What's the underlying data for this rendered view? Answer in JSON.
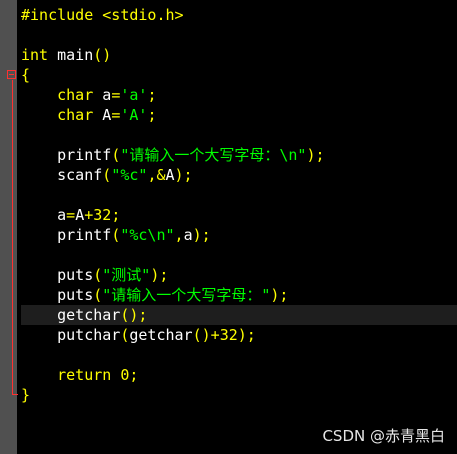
{
  "editor": {
    "lines": [
      [
        {
          "t": "#include <stdio.h>",
          "c": "pre"
        }
      ],
      [],
      [
        {
          "t": "int",
          "c": "kw"
        },
        {
          "t": " main",
          "c": "id"
        },
        {
          "t": "()",
          "c": "br"
        }
      ],
      [
        {
          "t": "{",
          "c": "br"
        }
      ],
      [
        {
          "t": "    char",
          "c": "kw"
        },
        {
          "t": " a",
          "c": "id"
        },
        {
          "t": "=",
          "c": "op"
        },
        {
          "t": "'a'",
          "c": "str"
        },
        {
          "t": ";",
          "c": "op"
        }
      ],
      [
        {
          "t": "    char",
          "c": "kw"
        },
        {
          "t": " A",
          "c": "id"
        },
        {
          "t": "=",
          "c": "op"
        },
        {
          "t": "'A'",
          "c": "str"
        },
        {
          "t": ";",
          "c": "op"
        }
      ],
      [],
      [
        {
          "t": "    printf",
          "c": "id"
        },
        {
          "t": "(",
          "c": "br"
        },
        {
          "t": "\"请输入一个大写字母：\\n\"",
          "c": "str"
        },
        {
          "t": ");",
          "c": "op"
        }
      ],
      [
        {
          "t": "    scanf",
          "c": "id"
        },
        {
          "t": "(",
          "c": "br"
        },
        {
          "t": "\"%c\"",
          "c": "str"
        },
        {
          "t": ",&",
          "c": "op"
        },
        {
          "t": "A",
          "c": "id"
        },
        {
          "t": ");",
          "c": "op"
        }
      ],
      [],
      [
        {
          "t": "    a",
          "c": "id"
        },
        {
          "t": "=",
          "c": "op"
        },
        {
          "t": "A",
          "c": "id"
        },
        {
          "t": "+",
          "c": "op"
        },
        {
          "t": "32",
          "c": "num"
        },
        {
          "t": ";",
          "c": "op"
        }
      ],
      [
        {
          "t": "    printf",
          "c": "id"
        },
        {
          "t": "(",
          "c": "br"
        },
        {
          "t": "\"%c\\n\"",
          "c": "str"
        },
        {
          "t": ",",
          "c": "op"
        },
        {
          "t": "a",
          "c": "id"
        },
        {
          "t": ");",
          "c": "op"
        }
      ],
      [],
      [
        {
          "t": "    puts",
          "c": "id"
        },
        {
          "t": "(",
          "c": "br"
        },
        {
          "t": "\"测试\"",
          "c": "str"
        },
        {
          "t": ");",
          "c": "op"
        }
      ],
      [
        {
          "t": "    puts",
          "c": "id"
        },
        {
          "t": "(",
          "c": "br"
        },
        {
          "t": "\"请输入一个大写字母：\"",
          "c": "str"
        },
        {
          "t": ");",
          "c": "op"
        }
      ],
      [
        {
          "t": "    getchar",
          "c": "id"
        },
        {
          "t": "();",
          "c": "op"
        }
      ],
      [
        {
          "t": "    putchar",
          "c": "id"
        },
        {
          "t": "(",
          "c": "br"
        },
        {
          "t": "getchar",
          "c": "id"
        },
        {
          "t": "()+",
          "c": "op"
        },
        {
          "t": "32",
          "c": "num"
        },
        {
          "t": ");",
          "c": "op"
        }
      ],
      [],
      [
        {
          "t": "    return",
          "c": "kw"
        },
        {
          "t": " 0",
          "c": "num"
        },
        {
          "t": ";",
          "c": "op"
        }
      ],
      [
        {
          "t": "}",
          "c": "br"
        }
      ]
    ],
    "current_line_index": 15
  },
  "watermark": "CSDN @赤青黑白"
}
